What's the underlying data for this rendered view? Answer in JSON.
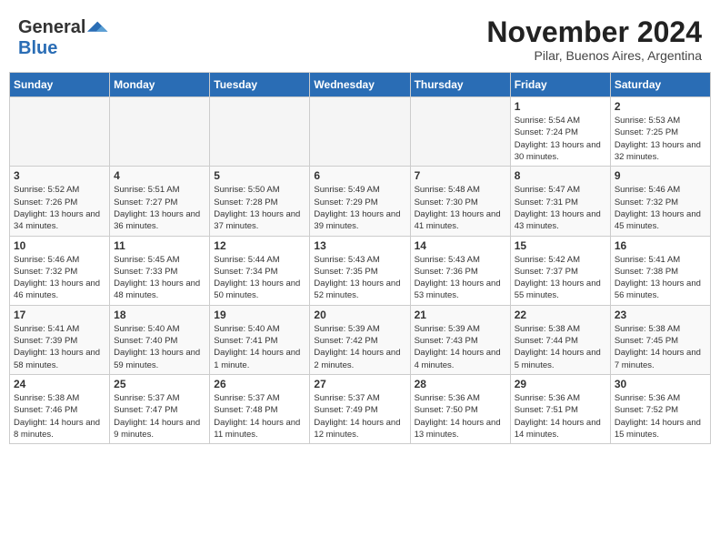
{
  "logo": {
    "general": "General",
    "blue": "Blue"
  },
  "title": {
    "month": "November 2024",
    "location": "Pilar, Buenos Aires, Argentina"
  },
  "weekdays": [
    "Sunday",
    "Monday",
    "Tuesday",
    "Wednesday",
    "Thursday",
    "Friday",
    "Saturday"
  ],
  "weeks": [
    [
      {
        "day": "",
        "empty": true
      },
      {
        "day": "",
        "empty": true
      },
      {
        "day": "",
        "empty": true
      },
      {
        "day": "",
        "empty": true
      },
      {
        "day": "",
        "empty": true
      },
      {
        "day": "1",
        "sunrise": "5:54 AM",
        "sunset": "7:24 PM",
        "daylight": "13 hours and 30 minutes."
      },
      {
        "day": "2",
        "sunrise": "5:53 AM",
        "sunset": "7:25 PM",
        "daylight": "13 hours and 32 minutes."
      }
    ],
    [
      {
        "day": "3",
        "sunrise": "5:52 AM",
        "sunset": "7:26 PM",
        "daylight": "13 hours and 34 minutes."
      },
      {
        "day": "4",
        "sunrise": "5:51 AM",
        "sunset": "7:27 PM",
        "daylight": "13 hours and 36 minutes."
      },
      {
        "day": "5",
        "sunrise": "5:50 AM",
        "sunset": "7:28 PM",
        "daylight": "13 hours and 37 minutes."
      },
      {
        "day": "6",
        "sunrise": "5:49 AM",
        "sunset": "7:29 PM",
        "daylight": "13 hours and 39 minutes."
      },
      {
        "day": "7",
        "sunrise": "5:48 AM",
        "sunset": "7:30 PM",
        "daylight": "13 hours and 41 minutes."
      },
      {
        "day": "8",
        "sunrise": "5:47 AM",
        "sunset": "7:31 PM",
        "daylight": "13 hours and 43 minutes."
      },
      {
        "day": "9",
        "sunrise": "5:46 AM",
        "sunset": "7:32 PM",
        "daylight": "13 hours and 45 minutes."
      }
    ],
    [
      {
        "day": "10",
        "sunrise": "5:46 AM",
        "sunset": "7:32 PM",
        "daylight": "13 hours and 46 minutes."
      },
      {
        "day": "11",
        "sunrise": "5:45 AM",
        "sunset": "7:33 PM",
        "daylight": "13 hours and 48 minutes."
      },
      {
        "day": "12",
        "sunrise": "5:44 AM",
        "sunset": "7:34 PM",
        "daylight": "13 hours and 50 minutes."
      },
      {
        "day": "13",
        "sunrise": "5:43 AM",
        "sunset": "7:35 PM",
        "daylight": "13 hours and 52 minutes."
      },
      {
        "day": "14",
        "sunrise": "5:43 AM",
        "sunset": "7:36 PM",
        "daylight": "13 hours and 53 minutes."
      },
      {
        "day": "15",
        "sunrise": "5:42 AM",
        "sunset": "7:37 PM",
        "daylight": "13 hours and 55 minutes."
      },
      {
        "day": "16",
        "sunrise": "5:41 AM",
        "sunset": "7:38 PM",
        "daylight": "13 hours and 56 minutes."
      }
    ],
    [
      {
        "day": "17",
        "sunrise": "5:41 AM",
        "sunset": "7:39 PM",
        "daylight": "13 hours and 58 minutes."
      },
      {
        "day": "18",
        "sunrise": "5:40 AM",
        "sunset": "7:40 PM",
        "daylight": "13 hours and 59 minutes."
      },
      {
        "day": "19",
        "sunrise": "5:40 AM",
        "sunset": "7:41 PM",
        "daylight": "14 hours and 1 minute."
      },
      {
        "day": "20",
        "sunrise": "5:39 AM",
        "sunset": "7:42 PM",
        "daylight": "14 hours and 2 minutes."
      },
      {
        "day": "21",
        "sunrise": "5:39 AM",
        "sunset": "7:43 PM",
        "daylight": "14 hours and 4 minutes."
      },
      {
        "day": "22",
        "sunrise": "5:38 AM",
        "sunset": "7:44 PM",
        "daylight": "14 hours and 5 minutes."
      },
      {
        "day": "23",
        "sunrise": "5:38 AM",
        "sunset": "7:45 PM",
        "daylight": "14 hours and 7 minutes."
      }
    ],
    [
      {
        "day": "24",
        "sunrise": "5:38 AM",
        "sunset": "7:46 PM",
        "daylight": "14 hours and 8 minutes."
      },
      {
        "day": "25",
        "sunrise": "5:37 AM",
        "sunset": "7:47 PM",
        "daylight": "14 hours and 9 minutes."
      },
      {
        "day": "26",
        "sunrise": "5:37 AM",
        "sunset": "7:48 PM",
        "daylight": "14 hours and 11 minutes."
      },
      {
        "day": "27",
        "sunrise": "5:37 AM",
        "sunset": "7:49 PM",
        "daylight": "14 hours and 12 minutes."
      },
      {
        "day": "28",
        "sunrise": "5:36 AM",
        "sunset": "7:50 PM",
        "daylight": "14 hours and 13 minutes."
      },
      {
        "day": "29",
        "sunrise": "5:36 AM",
        "sunset": "7:51 PM",
        "daylight": "14 hours and 14 minutes."
      },
      {
        "day": "30",
        "sunrise": "5:36 AM",
        "sunset": "7:52 PM",
        "daylight": "14 hours and 15 minutes."
      }
    ]
  ]
}
